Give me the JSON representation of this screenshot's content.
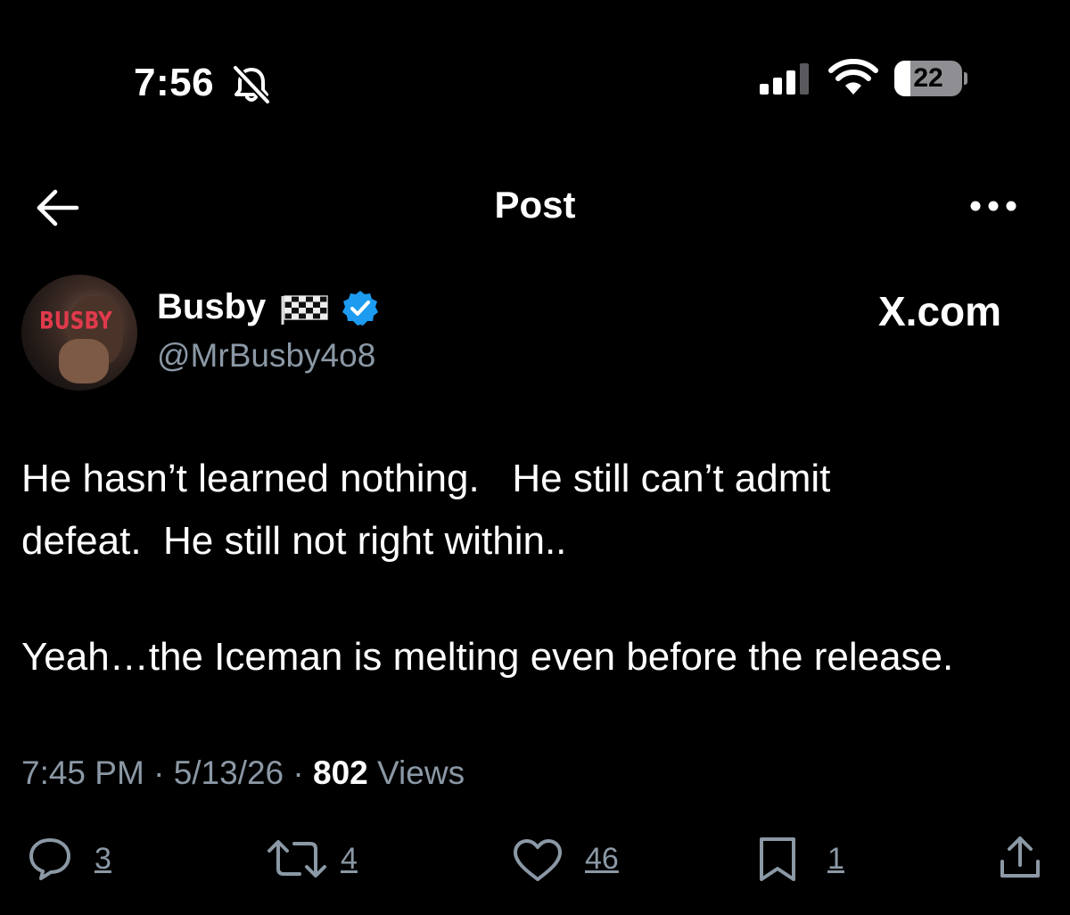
{
  "status_bar": {
    "time": "7:56",
    "battery": "22",
    "battery_level": 0.22,
    "icons": [
      "bell-slash-icon",
      "cellular-signal-icon",
      "wifi-icon",
      "battery-icon"
    ]
  },
  "nav": {
    "title": "Post",
    "back_icon": "arrow-left-icon",
    "more_icon": "more-dots-icon"
  },
  "post": {
    "author": {
      "display_name": "Busby",
      "name_emoji_icon": "checkered-flag-icon",
      "verified_icon": "verified-badge-icon",
      "verified_color": "#1d9bf0",
      "handle": "@MrBusby4o8",
      "avatar_logo_text": "BUSBY"
    },
    "source_watermark": "X.com",
    "text_lines": [
      "He hasn’t learned nothing.   He still can’t admit",
      "defeat.  He still not right within..",
      "Yeah…the Iceman is melting even before the release."
    ],
    "meta": {
      "time": "7:45 PM",
      "separator": " · ",
      "date": "5/13/26",
      "views_count": "802",
      "views_label": " Views"
    },
    "actions": {
      "reply": {
        "icon": "reply-bubble-icon",
        "count": "3"
      },
      "repost": {
        "icon": "repost-icon",
        "count": "4"
      },
      "like": {
        "icon": "heart-icon",
        "count": "46"
      },
      "bookmark": {
        "icon": "bookmark-icon",
        "count": "1"
      },
      "share": {
        "icon": "share-icon"
      }
    }
  },
  "colors": {
    "background": "#000000",
    "text_primary": "#ffffff",
    "text_secondary": "#8b98a5",
    "verified_blue": "#1d9bf0"
  }
}
